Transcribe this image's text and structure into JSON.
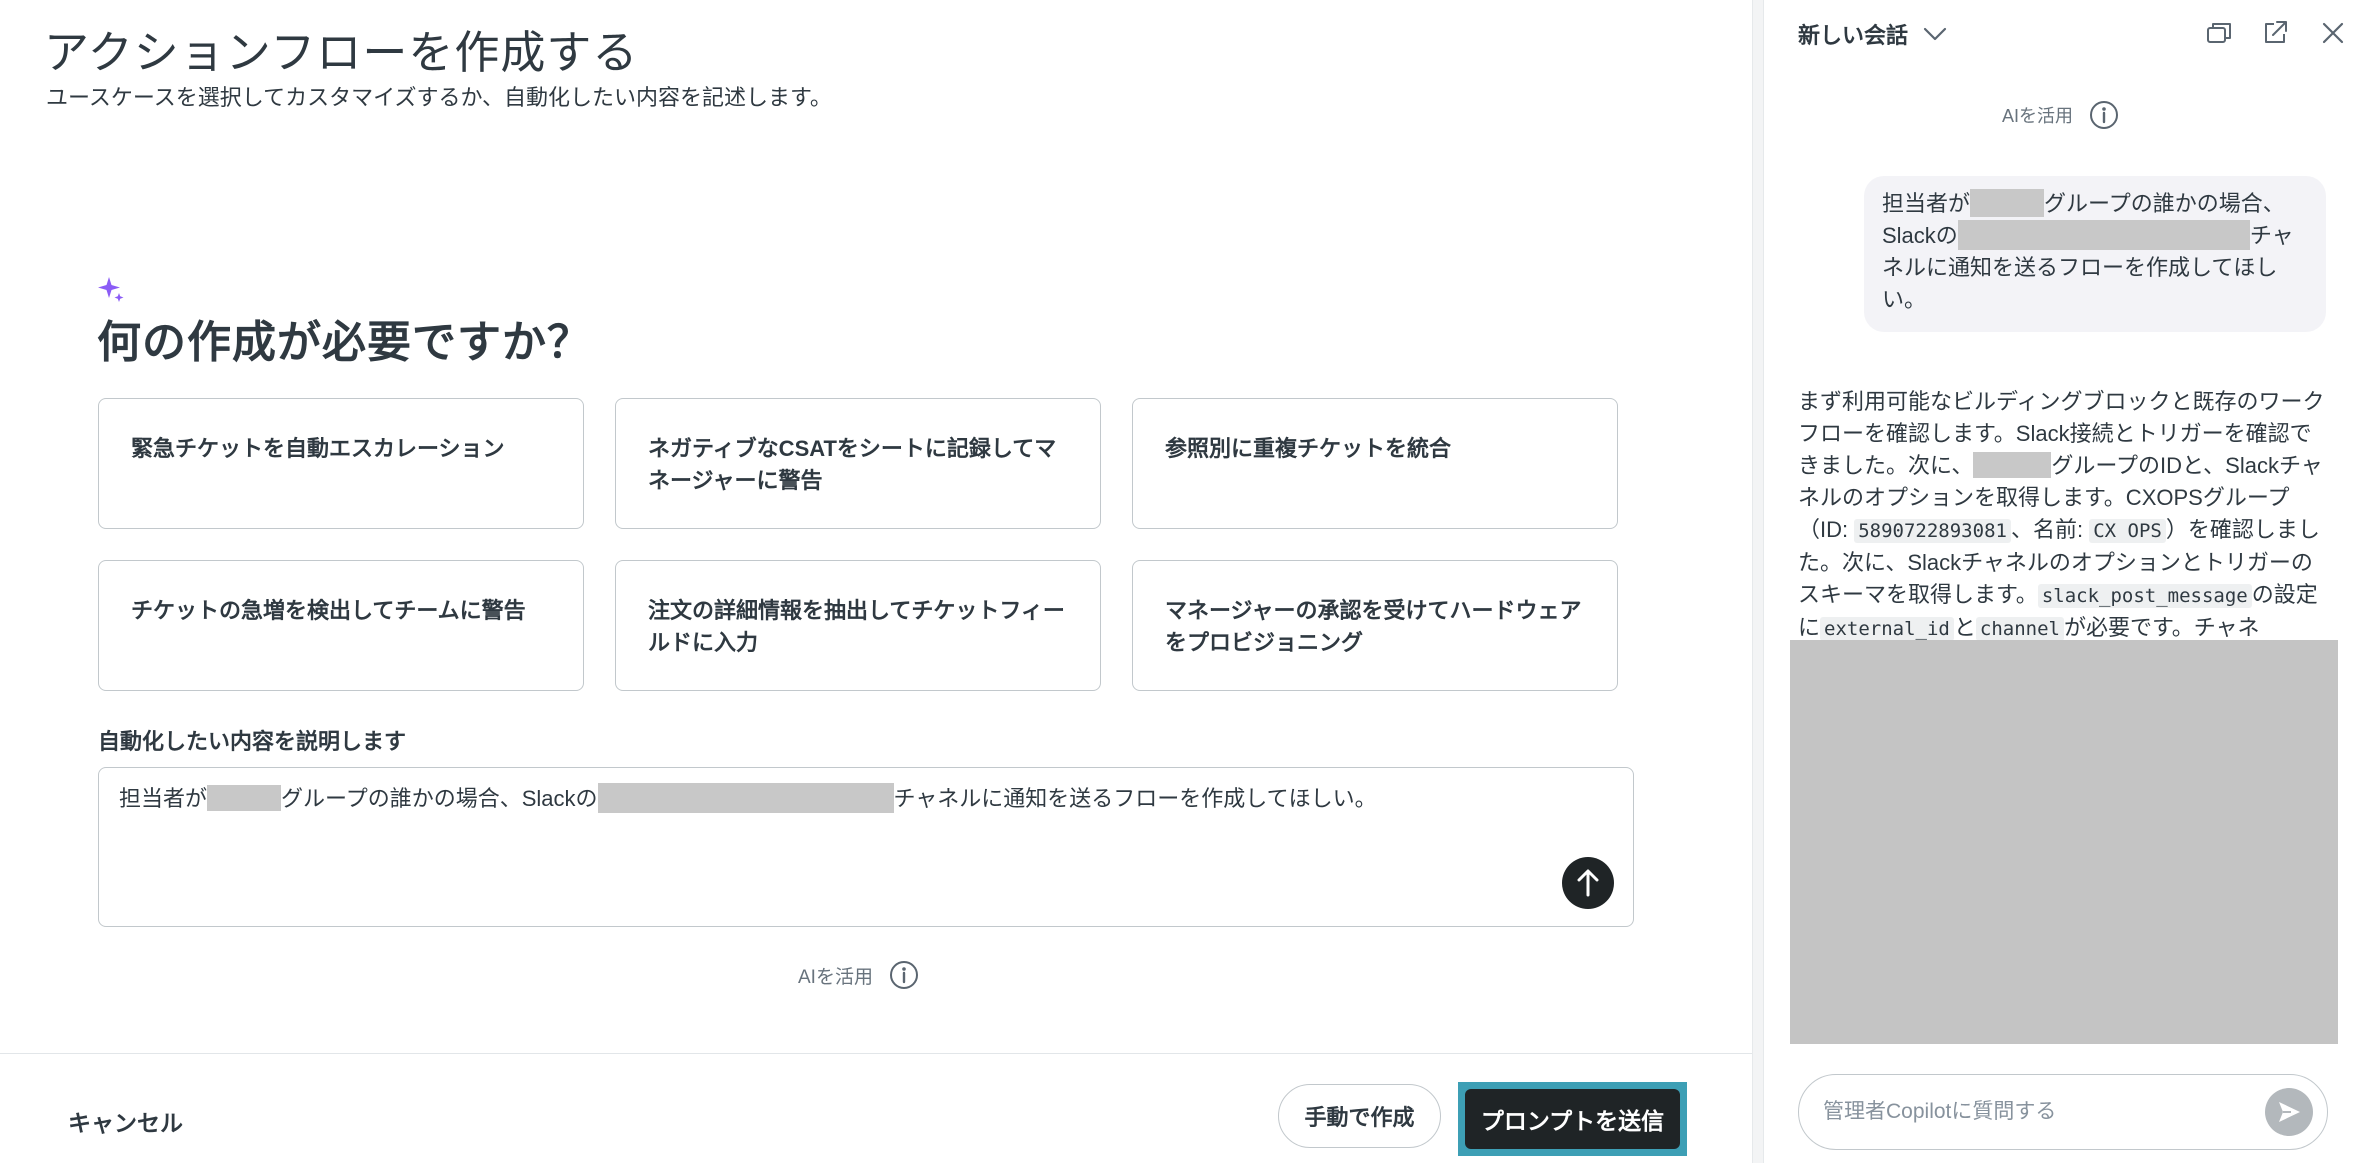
{
  "main": {
    "title": "アクションフローを作成する",
    "subtitle": "ユースケースを選択してカスタマイズするか、自動化したい内容を記述します。",
    "question": "何の作成が必要ですか？",
    "cards": [
      {
        "label": "緊急チケットを自動エスカレーション"
      },
      {
        "label": "ネガティブなCSATをシートに記録してマネージャーに警告"
      },
      {
        "label": "参照別に重複チケットを統合"
      },
      {
        "label": "チケットの急増を検出してチームに警告"
      },
      {
        "label": "注文の詳細情報を抽出してチケットフィールドに入力"
      },
      {
        "label": "マネージャーの承認を受けてハードウェアをプロビジョニング"
      }
    ],
    "description_label": "自動化したい内容を説明します",
    "description": {
      "part1": "担当者が",
      "part2": "グループの誰かの場合、Slackの",
      "part3": "チャネルに通知を送るフローを作成してほしい。"
    },
    "ai_note": "AIを活用"
  },
  "footer": {
    "cancel_label": "キャンセル",
    "manual_label": "手動で作成",
    "submit_label": "プロンプトを送信"
  },
  "copilot": {
    "title": "新しい会話",
    "ai_note": "AIを活用",
    "user_message": {
      "part1": "担当者が",
      "part2": "グループの誰かの場合、Slackの",
      "part3": "チャネルに通知を送るフローを作成してほしい。"
    },
    "assistant_message": {
      "t1": "まず利用可能なビルディングブロックと既存のワークフローを確認します。Slack接続とトリガーを確認できました。次に、",
      "t2": "グループのIDと、Slackチャネルのオプションを取得します。CXOPSグループ（ID: ",
      "code_id": "5890722893081",
      "t3": "、名前: ",
      "code_name": "CX OPS",
      "t4": "）を確認しました。次に、Slackチャネルのオプションとトリガーのスキーマを取得します。",
      "code_action": "slack_post_message",
      "t5": "の設定に",
      "code_external": "external_id",
      "t6": "と",
      "code_channel": "channel",
      "t7": "が必要です。チャネ"
    },
    "ask_placeholder": "管理者Copilotに質問する"
  },
  "icons": {
    "sparkle": "sparkle-icon",
    "info": "info-icon",
    "arrow_up": "arrow-up-icon",
    "chevron": "chevron-down-icon",
    "windows": "windows-icon",
    "popout": "popout-icon",
    "close": "close-icon",
    "send": "send-icon"
  },
  "colors": {
    "accent_purple": "#8b5cf6",
    "dark_button": "#1f2426",
    "focus_ring": "#3d9fb5",
    "redaction": "#c8c8c8"
  }
}
